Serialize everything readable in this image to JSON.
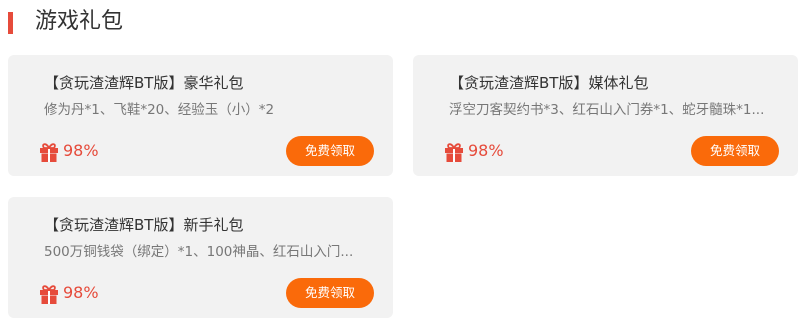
{
  "section": {
    "title": "游戏礼包"
  },
  "colors": {
    "accent": "#e64b3b",
    "button": "#fa6a0a",
    "card_bg": "#f2f2f2"
  },
  "packs": [
    {
      "name": "【贪玩渣渣辉BT版】豪华礼包",
      "desc": "修为丹*1、飞鞋*20、经验玉（小）*2",
      "percent": "98%",
      "button": "免费领取",
      "icon": "gift-icon"
    },
    {
      "name": "【贪玩渣渣辉BT版】媒体礼包",
      "desc": "浮空刀客契约书*3、红石山入门券*1、蛇牙髓珠*1...",
      "percent": "98%",
      "button": "免费领取",
      "icon": "gift-icon"
    },
    {
      "name": "【贪玩渣渣辉BT版】新手礼包",
      "desc": "500万铜钱袋（绑定）*1、100神晶、红石山入门...",
      "percent": "98%",
      "button": "免费领取",
      "icon": "gift-icon"
    }
  ]
}
